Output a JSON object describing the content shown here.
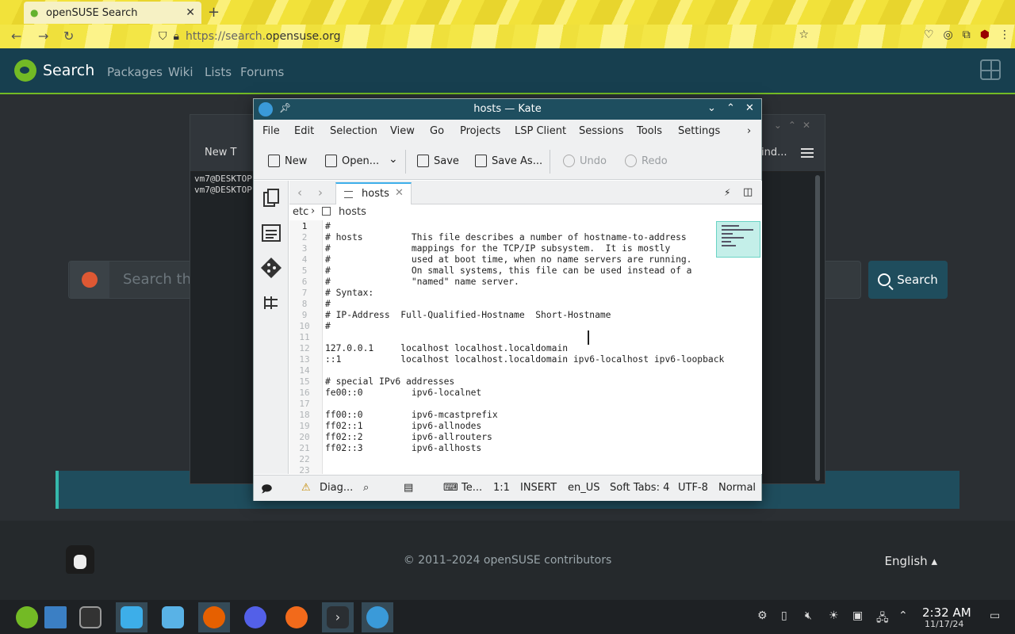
{
  "browser": {
    "tab_title": "openSUSE Search",
    "tab_close": "✕",
    "new_tab": "+",
    "url_scheme": "https://search.",
    "url_domain": "opensuse.org"
  },
  "site": {
    "title": "Search",
    "nav": [
      "Packages",
      "Wiki",
      "Lists",
      "Forums"
    ],
    "search_placeholder": "Search the",
    "search_button": "Search",
    "copyright": "© 2011–2024 openSUSE contributors",
    "language": "English ▴"
  },
  "konsole": {
    "new_tab": "New T",
    "find": "ind...",
    "lines": [
      "vm7@DESKTOP",
      "vm7@DESKTOP"
    ]
  },
  "kate": {
    "window_title": "hosts — Kate",
    "menu": [
      "File",
      "Edit",
      "Selection",
      "View",
      "Go",
      "Projects",
      "LSP Client",
      "Sessions",
      "Tools",
      "Settings"
    ],
    "toolbar": {
      "new": "New",
      "open": "Open...",
      "save": "Save",
      "save_as": "Save As...",
      "undo": "Undo",
      "redo": "Redo"
    },
    "tab_name": "hosts",
    "breadcrumb": [
      "etc",
      "hosts"
    ],
    "code_lines": [
      "#",
      "# hosts         This file describes a number of hostname-to-address",
      "#               mappings for the TCP/IP subsystem.  It is mostly",
      "#               used at boot time, when no name servers are running.",
      "#               On small systems, this file can be used instead of a",
      "#               \"named\" name server.",
      "# Syntax:",
      "#",
      "# IP-Address  Full-Qualified-Hostname  Short-Hostname",
      "#",
      "",
      "127.0.0.1     localhost localhost.localdomain",
      "::1           localhost localhost.localdomain ipv6-localhost ipv6-loopback",
      "",
      "# special IPv6 addresses",
      "fe00::0         ipv6-localnet",
      "",
      "ff00::0         ipv6-mcastprefix",
      "ff02::1         ipv6-allnodes",
      "ff02::2         ipv6-allrouters",
      "ff02::3         ipv6-allhosts",
      "",
      ""
    ],
    "status": {
      "diag": "Diag...",
      "terminal": "Te...",
      "position": "1:1",
      "mode": "INSERT",
      "lang": "en_US",
      "tabs": "Soft Tabs: 4",
      "encoding": "UTF-8",
      "vimode": "Normal"
    }
  },
  "taskbar": {
    "time": "2:32 AM",
    "date": "11/17/24"
  }
}
